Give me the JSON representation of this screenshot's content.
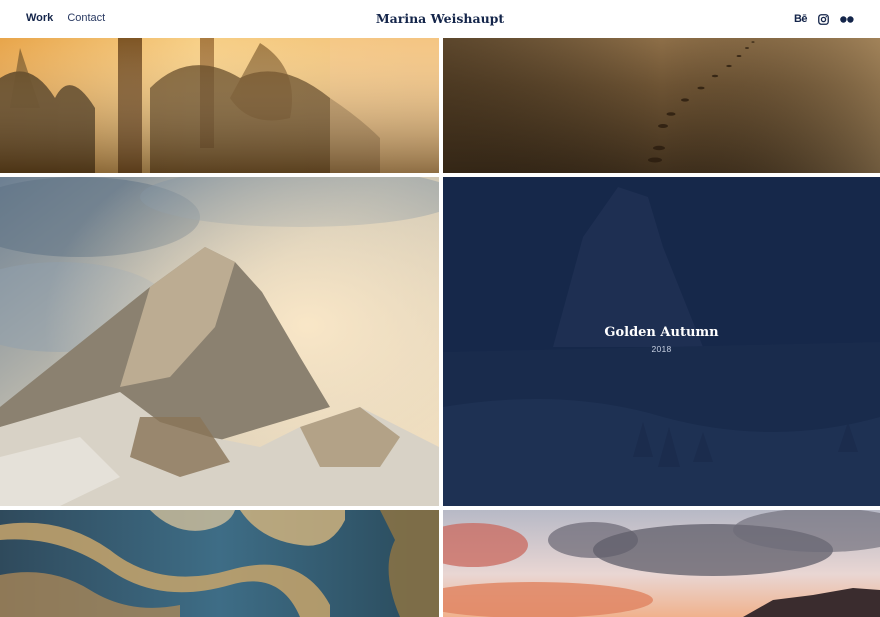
{
  "nav": {
    "items": [
      {
        "label": "Work",
        "active": true
      },
      {
        "label": "Contact",
        "active": false
      }
    ]
  },
  "brand": {
    "name": "Marina Weishaupt"
  },
  "social": {
    "items": [
      {
        "icon": "behance-icon",
        "glyph": "Bē"
      },
      {
        "icon": "instagram-icon"
      },
      {
        "icon": "flickr-icon"
      }
    ]
  },
  "gallery": {
    "featured": {
      "title": "Golden Autumn",
      "year": "2018"
    }
  },
  "colors": {
    "primary": "#14254a",
    "overlay": "#15264a",
    "background": "#ffffff"
  }
}
